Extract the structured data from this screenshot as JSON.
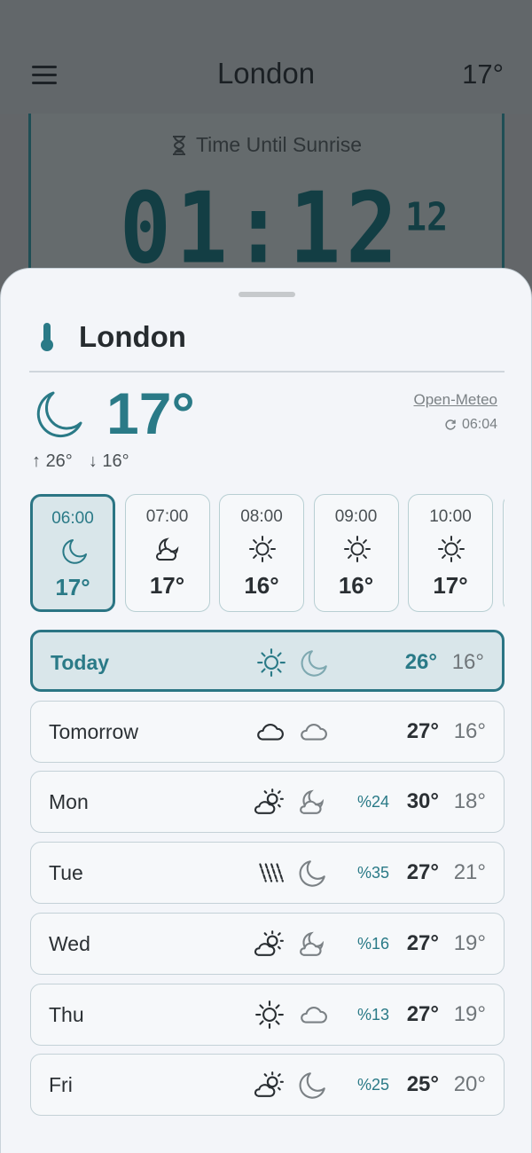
{
  "header": {
    "title": "London",
    "temperature": "17°"
  },
  "countdown": {
    "label": "Time Until Sunrise",
    "time": "01:12",
    "seconds": "12"
  },
  "sheet": {
    "title": "London",
    "current": {
      "temperature": "17°",
      "high": "26°",
      "low": "16°",
      "icon": "moon-icon"
    },
    "source": "Open-Meteo",
    "updated": "06:04",
    "hourly": [
      {
        "time": "06:00",
        "temp": "17°",
        "icon": "moon"
      },
      {
        "time": "07:00",
        "temp": "17°",
        "icon": "moon-cloud"
      },
      {
        "time": "08:00",
        "temp": "16°",
        "icon": "sun"
      },
      {
        "time": "09:00",
        "temp": "16°",
        "icon": "sun"
      },
      {
        "time": "10:00",
        "temp": "17°",
        "icon": "sun"
      }
    ],
    "daily": [
      {
        "day": "Today",
        "icon_day": "sun",
        "icon_night": "moon",
        "pop": "",
        "high": "26°",
        "low": "16°"
      },
      {
        "day": "Tomorrow",
        "icon_day": "cloud",
        "icon_night": "cloud",
        "pop": "",
        "high": "27°",
        "low": "16°"
      },
      {
        "day": "Mon",
        "icon_day": "sun-cloud",
        "icon_night": "moon-cloud",
        "pop": "%24",
        "high": "30°",
        "low": "18°"
      },
      {
        "day": "Tue",
        "icon_day": "rain",
        "icon_night": "moon",
        "pop": "%35",
        "high": "27°",
        "low": "21°"
      },
      {
        "day": "Wed",
        "icon_day": "sun-cloud",
        "icon_night": "moon-cloud",
        "pop": "%16",
        "high": "27°",
        "low": "19°"
      },
      {
        "day": "Thu",
        "icon_day": "sun",
        "icon_night": "cloud",
        "pop": "%13",
        "high": "27°",
        "low": "19°"
      },
      {
        "day": "Fri",
        "icon_day": "sun-cloud",
        "icon_night": "moon",
        "pop": "%25",
        "high": "25°",
        "low": "20°"
      }
    ]
  },
  "colors": {
    "accent": "#2a7a87",
    "dim_background": "#636669",
    "sheet_background": "#f3f5f9",
    "lcd": "#133e44"
  }
}
